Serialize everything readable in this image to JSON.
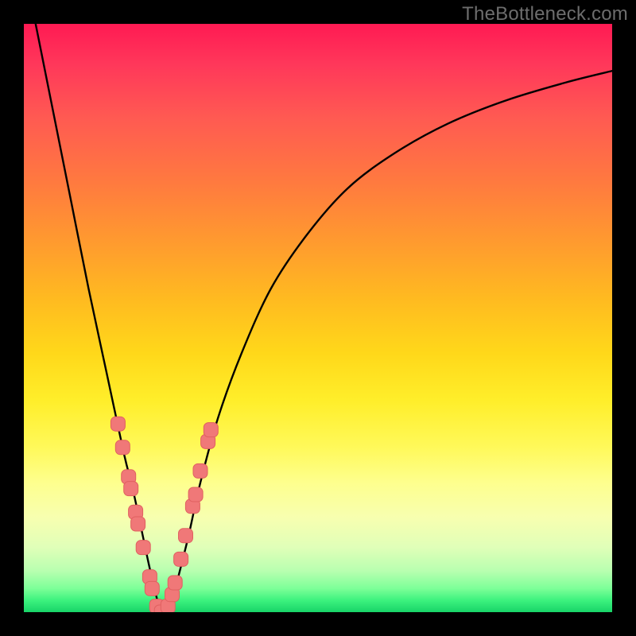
{
  "watermark": "TheBottleneck.com",
  "colors": {
    "curve": "#000000",
    "marker_fill": "#f07878",
    "marker_stroke": "#e06060",
    "frame": "#000000"
  },
  "chart_data": {
    "type": "line",
    "title": "",
    "xlabel": "",
    "ylabel": "",
    "xlim": [
      0,
      100
    ],
    "ylim": [
      0,
      100
    ],
    "note": "V-shaped bottleneck curve; y is percent mismatch vs x (relative performance). Values estimated from pixels.",
    "series": [
      {
        "name": "bottleneck-curve",
        "x": [
          2,
          5,
          8,
          11,
          14,
          17,
          18.5,
          20,
          21.5,
          23,
          24,
          25,
          26,
          28,
          30,
          33,
          37,
          42,
          48,
          55,
          63,
          72,
          82,
          92,
          100
        ],
        "y": [
          100,
          85,
          70,
          55,
          41,
          27,
          21,
          14,
          7,
          1,
          0,
          1,
          5,
          13,
          22,
          33,
          44,
          55,
          64,
          72,
          78,
          83,
          87,
          90,
          92
        ]
      }
    ],
    "markers": {
      "name": "highlighted-points",
      "shape": "rounded-square",
      "points": [
        {
          "x": 16.0,
          "y": 32
        },
        {
          "x": 16.8,
          "y": 28
        },
        {
          "x": 17.8,
          "y": 23
        },
        {
          "x": 18.2,
          "y": 21
        },
        {
          "x": 19.0,
          "y": 17
        },
        {
          "x": 19.4,
          "y": 15
        },
        {
          "x": 20.3,
          "y": 11
        },
        {
          "x": 21.4,
          "y": 6
        },
        {
          "x": 21.8,
          "y": 4
        },
        {
          "x": 22.6,
          "y": 1
        },
        {
          "x": 23.4,
          "y": 0
        },
        {
          "x": 24.5,
          "y": 1
        },
        {
          "x": 25.2,
          "y": 3
        },
        {
          "x": 25.7,
          "y": 5
        },
        {
          "x": 26.7,
          "y": 9
        },
        {
          "x": 27.5,
          "y": 13
        },
        {
          "x": 28.7,
          "y": 18
        },
        {
          "x": 29.2,
          "y": 20
        },
        {
          "x": 30.0,
          "y": 24
        },
        {
          "x": 31.3,
          "y": 29
        },
        {
          "x": 31.8,
          "y": 31
        }
      ]
    }
  }
}
